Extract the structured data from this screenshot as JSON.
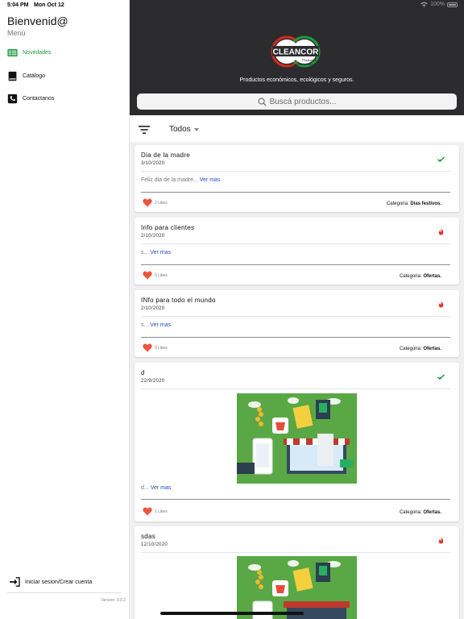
{
  "status_bar": {
    "time": "5:04 PM",
    "date": "Mon Oct 12",
    "battery": "100%"
  },
  "sidebar": {
    "title": "Bienvenid@",
    "subtitle": "Menú",
    "items": [
      {
        "label": "Novedades",
        "icon": "news-icon",
        "active": true
      },
      {
        "label": "Catálogo",
        "icon": "book-icon",
        "active": false
      },
      {
        "label": "Contactanos",
        "icon": "phone-icon",
        "active": false
      }
    ],
    "login_label": "Iniciar sesion/Crear cuenta",
    "version": "Version: 0.0.2"
  },
  "header": {
    "logo_text": "CLEANCOR",
    "logo_sub1": "Productos",
    "logo_sub2": "de higiene y limpieza",
    "tagline": "Productos económicos, ecológicos y seguros.",
    "search_placeholder": "Buscá productos..."
  },
  "filter": {
    "selected": "Todos"
  },
  "colors": {
    "accent": "#1e9a3c",
    "header_bg": "#2c2c2e",
    "link": "#2747c6",
    "heart": "#f0533f",
    "fire": "#e5342b"
  },
  "posts": [
    {
      "title": "Dia de la madre",
      "date": "3/10/2020",
      "status_icon": "check-icon",
      "description": "Feliz dia de la madre...",
      "more": "Ver mas",
      "likes": "2 Likes",
      "category_label": "Categoria:",
      "category": "Dias festivos."
    },
    {
      "title": "Info para clientes",
      "date": "2/10/2020",
      "status_icon": "fire-icon",
      "description": "s...",
      "more": "Ver mas",
      "likes": "0 Likes",
      "category_label": "Categoria:",
      "category": "Ofertas."
    },
    {
      "title": "INfo para todo el mundo",
      "date": "2/10/2020",
      "status_icon": "fire-icon",
      "description": "s...",
      "more": "Ver mas",
      "likes": "0 Likes",
      "category_label": "Categoria:",
      "category": "Ofertas."
    },
    {
      "title": "d",
      "date": "22/9/2020",
      "status_icon": "check-icon",
      "description": "d...",
      "more": "Ver mas",
      "likes": "1 Likes",
      "category_label": "Categoria:",
      "category": "Ofertas.",
      "image": "online-shop-illustration"
    },
    {
      "title": "sdas",
      "date": "12/10/2020",
      "status_icon": "fire-icon",
      "image": "online-shop-illustration"
    }
  ]
}
